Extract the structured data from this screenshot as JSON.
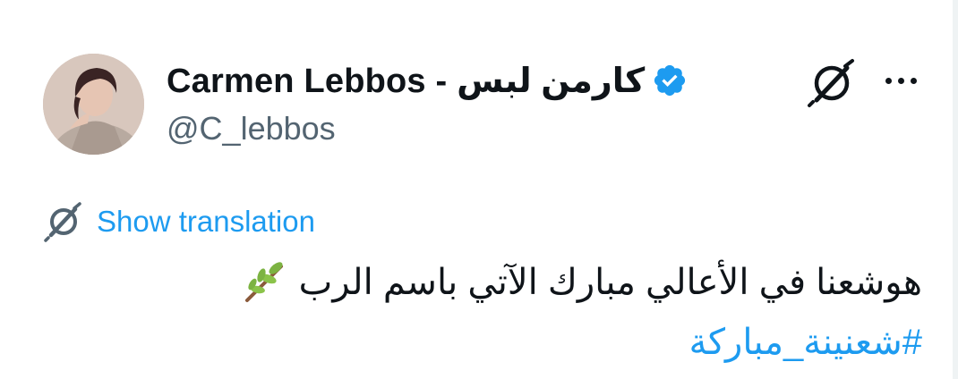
{
  "author": {
    "display_name": "Carmen Lebbos - كارمن لبس",
    "handle": "@C_lebbos",
    "verified": true,
    "accent_color": "#1d9bf0"
  },
  "actions": {
    "grok_icon": "grok-icon",
    "more_icon": "more-options-icon"
  },
  "translation": {
    "link_label": "Show translation",
    "icon": "translate-icon"
  },
  "tweet": {
    "text": "هوشعنا في الأعالي مبارك الآتي باسم الرب",
    "emoji_icon": "olive-branch-icon",
    "hashtag": "#شعنينة_مباركة"
  },
  "colors": {
    "text_primary": "#0f1419",
    "text_secondary": "#536471",
    "link": "#1d9bf0"
  }
}
